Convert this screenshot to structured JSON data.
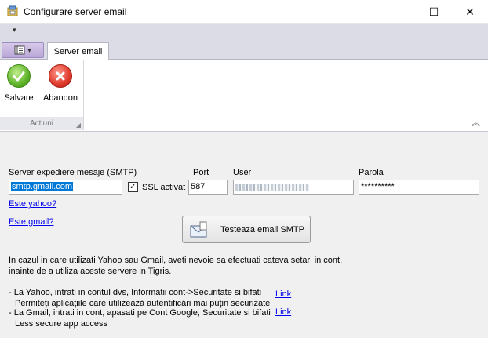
{
  "window": {
    "title": "Configurare server email",
    "minimize_symbol": "—",
    "maximize_symbol": "☐",
    "close_symbol": "✕"
  },
  "quick_access": {
    "dropdown_symbol": "▾"
  },
  "ribbon": {
    "tabs": [
      {
        "label": "Server email",
        "active": true
      }
    ],
    "groups": [
      {
        "label": "Actiuni",
        "buttons": [
          {
            "label": "Salvare",
            "icon": "check-icon"
          },
          {
            "label": "Abandon",
            "icon": "cancel-icon"
          }
        ]
      }
    ]
  },
  "form": {
    "smtp": {
      "label": "Server expediere mesaje (SMTP)",
      "value": "smtp.gmail.com"
    },
    "ssl": {
      "label": "SSL activat",
      "checked": true,
      "check_symbol": "✓"
    },
    "port": {
      "label": "Port",
      "value": "587"
    },
    "user": {
      "label": "User",
      "value": ""
    },
    "password": {
      "label": "Parola",
      "value": "**********"
    },
    "links": {
      "yahoo": "Este yahoo?",
      "gmail": "Este gmail?"
    },
    "test_button": "Testeaza email SMTP"
  },
  "info": {
    "line1": "In cazul in care utilizati Yahoo sau Gmail, aveti nevoie sa efectuati cateva setari in cont,",
    "line2": "inainte de a utiliza aceste servere in Tigris.",
    "yahoo_line1": "- La Yahoo, intrati in contul dvs, Informatii cont->Securitate si bifati",
    "yahoo_line2": "Permiteţi aplicaţiile care utilizează autentificări mai puţin securizate",
    "yahoo_link": "Link",
    "gmail_line1": "- La Gmail, intrati in cont, apasati pe Cont Google, Securitate si bifati",
    "gmail_line2": "Less secure app access",
    "gmail_link": "Link"
  },
  "colors": {
    "accent_selection": "#0078d7",
    "link": "#0000ee",
    "save_green": "#5fb42a",
    "cancel_red": "#de3b2c"
  }
}
